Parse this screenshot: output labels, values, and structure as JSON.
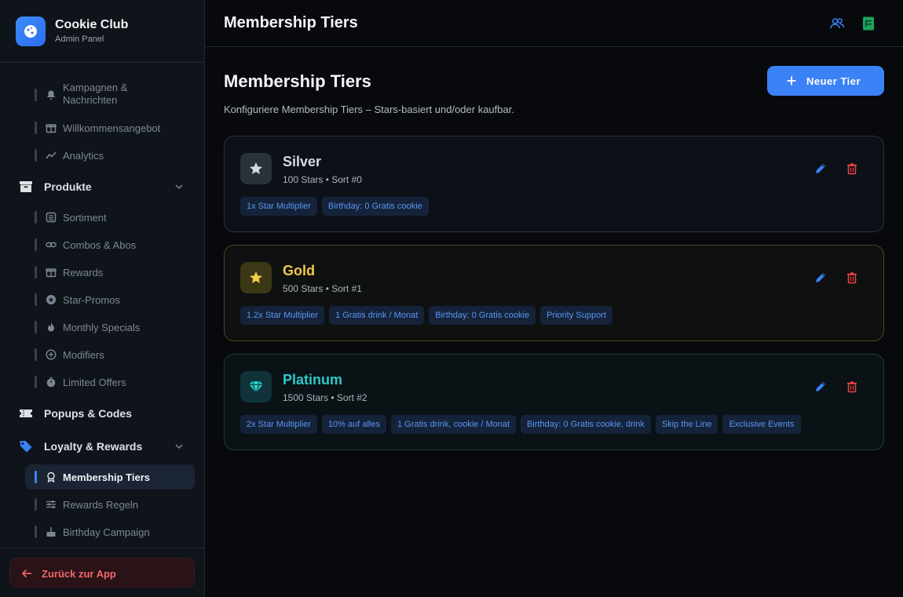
{
  "brand": {
    "title": "Cookie Club",
    "subtitle": "Admin Panel"
  },
  "sidebar": {
    "top_items": [
      {
        "label_line1": "Kampagnen &",
        "label_line2": "Nachrichten",
        "icon": "bell-icon"
      },
      {
        "label": "Willkommensangebot",
        "icon": "gift-icon"
      },
      {
        "label": "Analytics",
        "icon": "chart-line-icon"
      }
    ],
    "produkte": {
      "label": "Produkte",
      "items": [
        {
          "label": "Sortiment",
          "icon": "list-icon"
        },
        {
          "label": "Combos & Abos",
          "icon": "link-icon"
        },
        {
          "label": "Rewards",
          "icon": "gift-icon"
        },
        {
          "label": "Star-Promos",
          "icon": "star-circle-icon"
        },
        {
          "label": "Monthly Specials",
          "icon": "flame-icon"
        },
        {
          "label": "Modifiers",
          "icon": "plus-circle-icon"
        },
        {
          "label": "Limited Offers",
          "icon": "timer-icon"
        }
      ]
    },
    "popups": {
      "label": "Popups & Codes"
    },
    "loyalty": {
      "label": "Loyalty & Rewards",
      "items": [
        {
          "label": "Membership Tiers",
          "icon": "award-icon",
          "active": true
        },
        {
          "label": "Rewards Regeln",
          "icon": "sliders-icon"
        },
        {
          "label": "Birthday Campaign",
          "icon": "cake-icon"
        }
      ]
    },
    "back_label": "Zurück zur App"
  },
  "header": {
    "title": "Membership Tiers"
  },
  "main": {
    "title": "Membership Tiers",
    "description": "Konfiguriere Membership Tiers – Stars-basiert und/oder kaufbar.",
    "new_button_label": "Neuer Tier"
  },
  "tiers": [
    {
      "name": "Silver",
      "meta": "100 Stars • Sort #0",
      "color": "#d6d9de",
      "tags": [
        "1x Star Multiplier",
        "Birthday: 0 Gratis cookie"
      ]
    },
    {
      "name": "Gold",
      "meta": "500 Stars • Sort #1",
      "color": "#f2c94c",
      "tags": [
        "1.2x Star Multiplier",
        "1 Gratis drink / Monat",
        "Birthday: 0 Gratis cookie",
        "Priority Support"
      ]
    },
    {
      "name": "Platinum",
      "meta": "1500 Stars • Sort #2",
      "color": "#2cc8c8",
      "tags": [
        "2x Star Multiplier",
        "10% auf alles",
        "1 Gratis drink, cookie / Monat",
        "Birthday: 0 Gratis cookie, drink",
        "Skip the Line",
        "Exclusive Events"
      ]
    }
  ],
  "colors": {
    "accent": "#3b82f6",
    "danger": "#ef4444",
    "gold": "#f2c94c",
    "platinum": "#2cc8c8"
  }
}
